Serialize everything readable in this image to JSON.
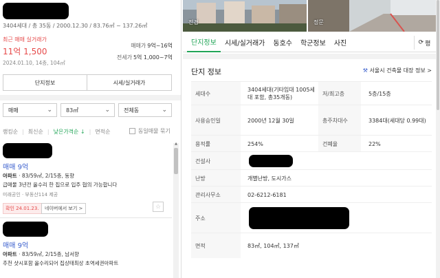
{
  "summary": {
    "meta": "3404세대 / 총 35동 / 2000.12.30 / 83.76㎡ ~ 137.26㎡",
    "recent_label": "최근 매매 실거래가",
    "recent_price": "11억 1,500",
    "recent_date": "2024.01.10, 14층, 104㎡",
    "sale_label": "매매가",
    "sale_range": "9억~16억",
    "jeonse_label": "전세가",
    "jeonse_range": "5억 1,000~7억"
  },
  "left_tabs": [
    "단지정보",
    "시세/실거래가"
  ],
  "filters": {
    "trade_type": "매매",
    "area": "83㎡",
    "building": "전체동"
  },
  "sort": {
    "options": [
      "랭킹순",
      "최신순",
      "낮은가격순 ↓",
      "면적순"
    ],
    "same_listing_label": "동일매물 묶기"
  },
  "listings": [
    {
      "title": "매매 9억",
      "detail_type": "아파트",
      "detail_rest": " · 83/59㎡, 2/15층, 동향",
      "description": "급매물 3년전 올수리 한 집으로 입주 협의 가능합니다",
      "agent_prefix": "미래공인 · 부동산114 제공",
      "confirm": "확인 24.01.23.",
      "naver_link": "네이버에서 보기 >",
      "star_icon": "star-icon"
    },
    {
      "title": "매매 9억",
      "detail_type": "아파트",
      "detail_rest": " · 83/59㎡, 2/15층, 남서향",
      "description": "추천 샷시포함 올수리되어 집상태최상 초역세권아파트"
    }
  ],
  "photos": [
    {
      "label": "전경"
    },
    {
      "label": "정문"
    }
  ],
  "right_tabs": [
    "단지정보",
    "시세/실거래가",
    "동호수",
    "학군정보",
    "사진"
  ],
  "refresh_label": "평",
  "section": {
    "title": "단지 정보",
    "building_link": "서울시 건축물 대장 정보 >"
  },
  "info_rows": [
    {
      "label": "세대수",
      "value": "3404세대(기타임대 1005세대 포함, 총35개동)",
      "label2": "저/최고층",
      "value2": "5층/15층"
    },
    {
      "label": "사용승인일",
      "value": "2000년 12월 30일",
      "label2": "총주차대수",
      "value2": "3384대(세대당 0.99대)"
    },
    {
      "label": "용적률",
      "value": "254%",
      "label2": "건폐율",
      "value2": "22%"
    },
    {
      "label": "건설사",
      "value": ""
    },
    {
      "label": "난방",
      "value": "개별난방, 도시가스"
    },
    {
      "label": "관리사무소",
      "value": "02-6212-6181"
    },
    {
      "label": "주소",
      "value": ""
    },
    {
      "label": "면적",
      "value": "83㎡, 104㎡, 137㎡"
    }
  ],
  "colors": {
    "accent_green": "#21a557",
    "price_red": "#e64a4a",
    "listing_blue": "#3a5fcd"
  }
}
